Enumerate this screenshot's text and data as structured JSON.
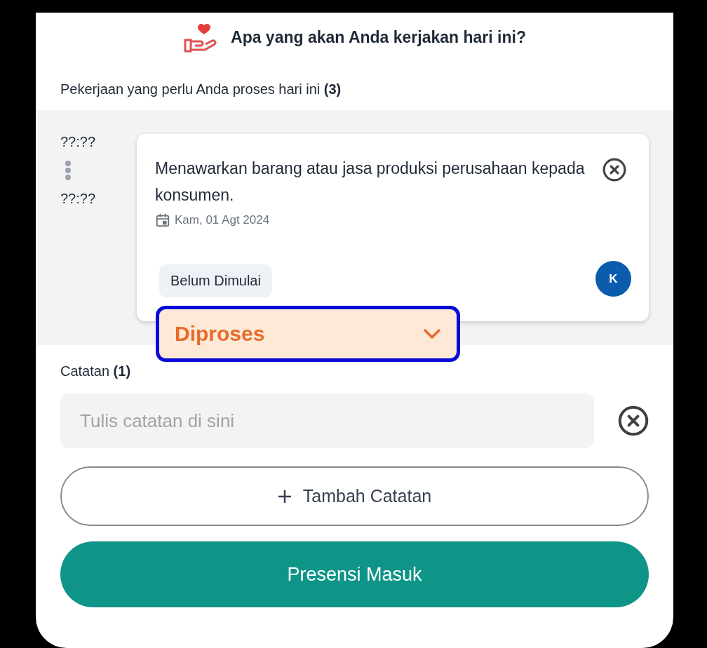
{
  "header": {
    "title": "Apa yang akan Anda kerjakan hari ini?"
  },
  "tasks_heading": "Pekerjaan yang perlu Anda proses hari ini **(3)**",
  "tasks": [
    {
      "start_time": "??:??",
      "end_time": "??:??",
      "title": "Menawarkan barang atau jasa produksi perusahaan kepada konsumen.",
      "date": "Kam, 01 Agt 2024",
      "status": "Belum Dimulai",
      "avatar": "K",
      "status_select": {
        "value": "Diproses",
        "focused": true
      }
    }
  ],
  "notes_heading": "Catatan **(1)**",
  "notes": [
    {
      "placeholder": "Tulis catatan di sini"
    }
  ],
  "add_note_button": "Tambah Catatan",
  "submit_button": "Presensi Masuk"
}
